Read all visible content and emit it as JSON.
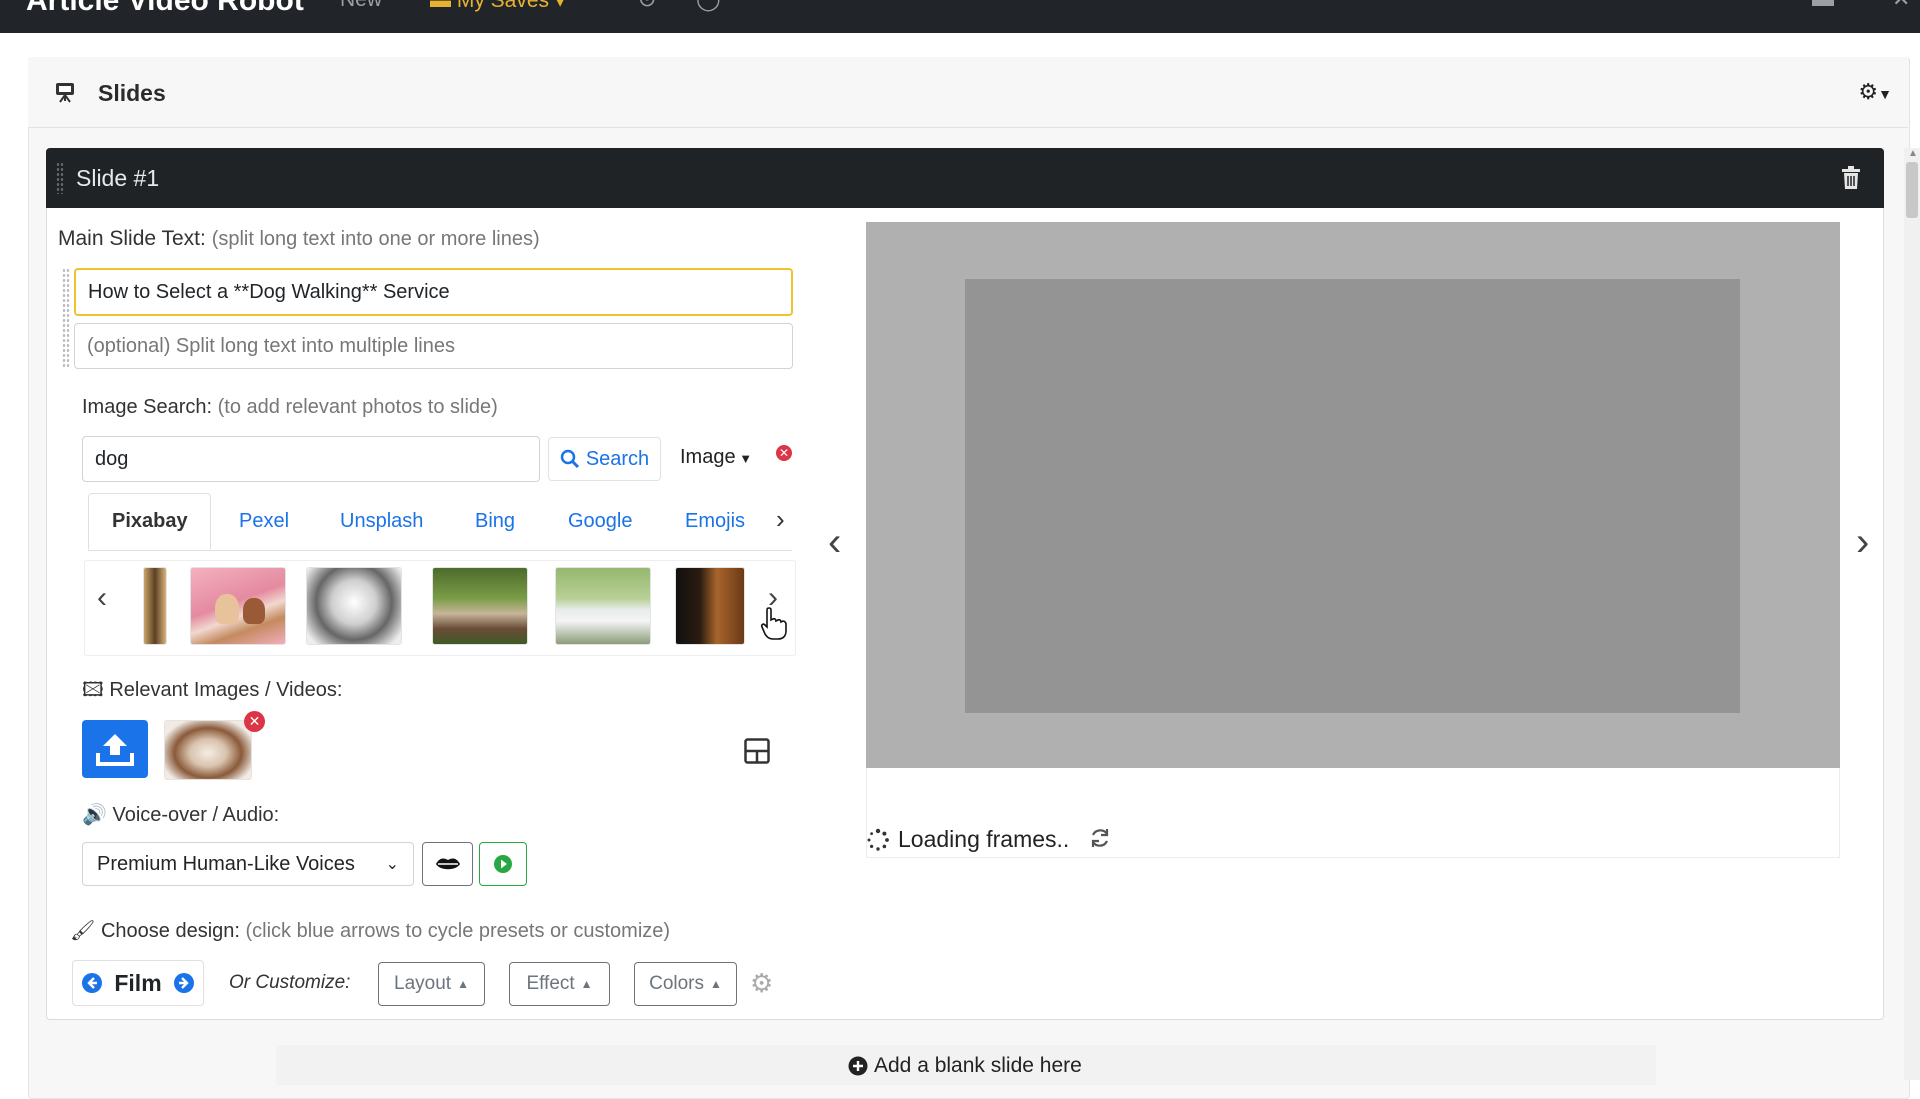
{
  "nav": {
    "brand": "Article Video Robot",
    "new_label": "New",
    "saves_label": "My Saves"
  },
  "slides_panel": {
    "title": "Slides"
  },
  "slide": {
    "title": "Slide #1",
    "main_text_label": "Main Slide Text:",
    "main_text_hint": "(split long text into one or more lines)",
    "line1_value": "How to Select a **Dog Walking** Service",
    "line2_placeholder": "(optional) Split long text into multiple lines",
    "image_search_label": "Image Search:",
    "image_search_hint": "(to add relevant photos to slide)",
    "search_value": "dog",
    "search_button": "Search",
    "type_dropdown": "Image",
    "tabs": [
      "Pixabay",
      "Pexel",
      "Unsplash",
      "Bing",
      "Google",
      "Emojis"
    ],
    "relevant_label": "Relevant Images / Videos:",
    "voice_label": "Voice-over / Audio:",
    "voice_select": "Premium Human-Like Voices",
    "design_label": "Choose design:",
    "design_hint": "(click blue arrows to cycle presets or customize)",
    "preset_name": "Film",
    "customize_label": "Or Customize:",
    "layout_btn": "Layout",
    "effect_btn": "Effect",
    "colors_btn": "Colors",
    "loading_text": "Loading frames.."
  },
  "add_slide": "Add a blank slide here",
  "colors": {
    "nav_bg": "#212529",
    "accent_blue": "#1a73e8",
    "focus_yellow": "#f0c22c",
    "danger_red": "#dc3545",
    "success_green": "#28a745"
  }
}
